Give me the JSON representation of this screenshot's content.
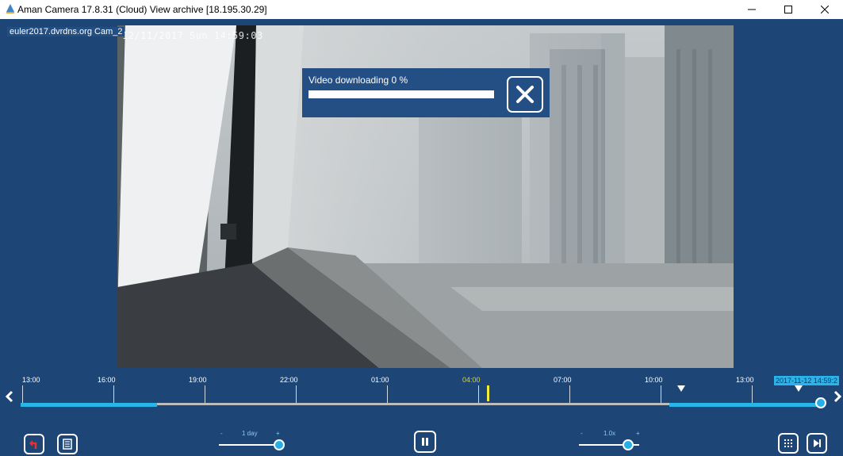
{
  "window": {
    "title": "Aman Camera 17.8.31 (Cloud) View archive [18.195.30.29]",
    "icons": [
      "app-icon",
      "minimize-icon",
      "maximize-icon",
      "close-icon"
    ]
  },
  "video": {
    "camera_label": "euler2017.dvrdns.org Cam_2",
    "osd_timestamp": "12/11/2017 Sun 14:59:03"
  },
  "download_dialog": {
    "text": "Video downloading 0 %",
    "progress": 0,
    "close_icon": "close-x-icon"
  },
  "timeline": {
    "tick_labels": [
      "13:00",
      "16:00",
      "19:00",
      "22:00",
      "01:00",
      "04:00",
      "07:00",
      "10:00",
      "13:00"
    ],
    "highlighted_tick_index": 5,
    "current_datetime": "2017-11-12 14:59:2",
    "prev_icon": "chevron-left-icon",
    "next_icon": "chevron-right-icon"
  },
  "controls": {
    "back_icon": "back-arrow-icon",
    "list_icon": "list-icon",
    "pause_icon": "pause-icon",
    "grid_icon": "grid-icon",
    "next_frame_icon": "skip-forward-icon",
    "zoom_slider": {
      "minus": "-",
      "value": "1 day",
      "plus": "+",
      "level": 1.0
    },
    "speed_slider": {
      "minus": "-",
      "value": "1.0x",
      "plus": "+",
      "level": 0.82
    }
  },
  "colors": {
    "background": "#1d4677",
    "accent": "#2ab5ea",
    "marker": "#f1ee3a"
  }
}
